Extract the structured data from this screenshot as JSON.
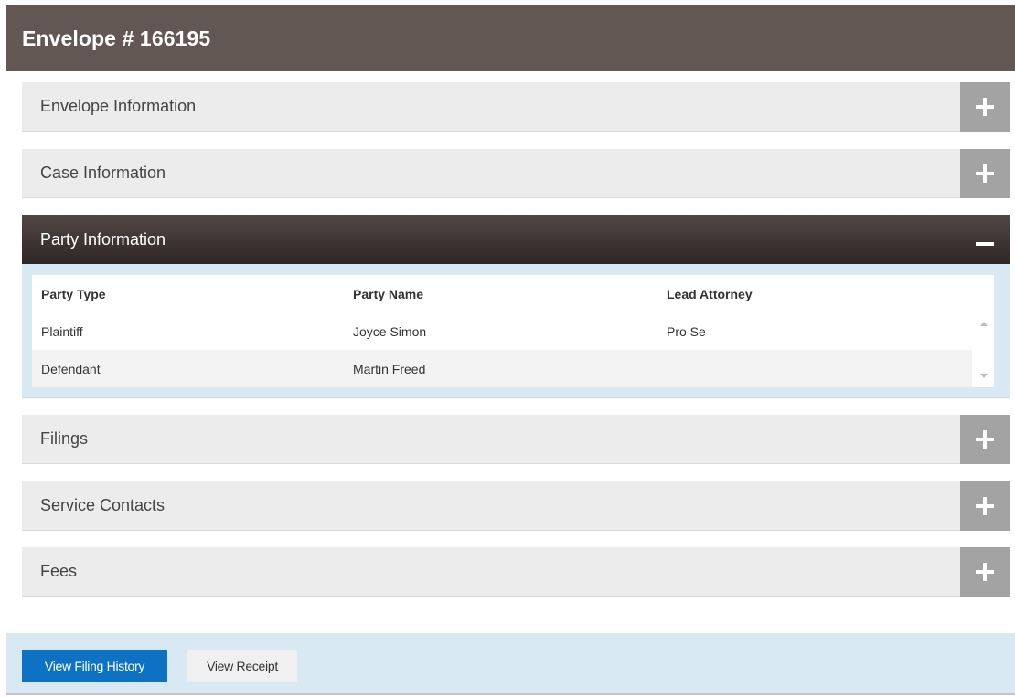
{
  "header": {
    "title": "Envelope # 166195"
  },
  "sections": [
    {
      "label": "Envelope Information",
      "state": "collapsed"
    },
    {
      "label": "Case Information",
      "state": "collapsed"
    },
    {
      "label": "Party Information",
      "state": "expanded"
    },
    {
      "label": "Filings",
      "state": "collapsed"
    },
    {
      "label": "Service Contacts",
      "state": "collapsed"
    },
    {
      "label": "Fees",
      "state": "collapsed"
    }
  ],
  "party_table": {
    "columns": [
      "Party Type",
      "Party Name",
      "Lead Attorney"
    ],
    "rows": [
      [
        "Plaintiff",
        "Joyce Simon",
        "Pro Se"
      ],
      [
        "Defendant",
        "Martin Freed",
        ""
      ]
    ]
  },
  "footer": {
    "view_filing_history": "View Filing History",
    "view_receipt": "View Receipt"
  },
  "colors": {
    "header_bg": "#635754",
    "expanded_section_bg": "#3f3533",
    "collapsed_section_bg": "#ececec",
    "toggle_bg": "#a3a3a3",
    "panel_bg": "#d9e9f4",
    "primary_button": "#0d72c4"
  },
  "icons": {
    "expand": "plus-icon",
    "collapse": "minus-icon",
    "scroll_up": "scroll-up-arrow-icon",
    "scroll_down": "scroll-down-arrow-icon"
  }
}
